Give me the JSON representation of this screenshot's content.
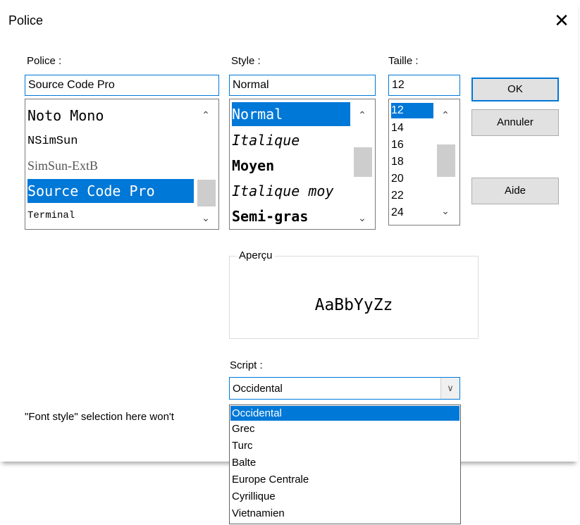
{
  "dialog": {
    "title": "Police",
    "close_label": "✕"
  },
  "font": {
    "label": "Police :",
    "value": "Source Code Pro",
    "items": [
      "Noto Mono",
      "NSimSun",
      "SimSun-ExtB",
      "Source Code Pro",
      "Terminal"
    ],
    "selected_index": 3
  },
  "style": {
    "label": "Style :",
    "value": "Normal",
    "items": [
      "Normal",
      "Italique",
      "Moyen",
      "Italique moу",
      "Semi-gras"
    ],
    "selected_index": 0
  },
  "size": {
    "label": "Taille :",
    "value": "12",
    "items": [
      "12",
      "14",
      "16",
      "18",
      "20",
      "22",
      "24"
    ],
    "selected_index": 0
  },
  "buttons": {
    "ok": "OK",
    "cancel": "Annuler",
    "help": "Aide"
  },
  "preview": {
    "label": "Aperçu",
    "sample": "AaBbYyZz"
  },
  "script": {
    "label": "Script :",
    "value": "Occidental",
    "options": [
      "Occidental",
      "Grec",
      "Turc",
      "Balte",
      "Europe Centrale",
      "Cyrillique",
      "Vietnamien"
    ],
    "selected_index": 0
  },
  "note": "\"Font style\" selection here won't",
  "icons": {
    "scroll_up": "⌃",
    "scroll_down": "⌄",
    "dropdown_arrow": "∨"
  }
}
